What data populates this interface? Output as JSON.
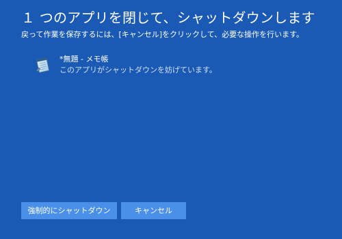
{
  "dialog": {
    "title": "１ つのアプリを閉じて、シャットダウンします",
    "subtitle": "戻って作業を保存するには、[キャンセル]をクリックして、必要な操作を行います。"
  },
  "apps": [
    {
      "name": "*無題 - メモ帳",
      "status": "このアプリがシャットダウンを妨げています。",
      "icon": "notepad-icon"
    }
  ],
  "buttons": {
    "force_shutdown_label": "強制的にシャットダウン",
    "cancel_label": "キャンセル"
  },
  "colors": {
    "background": "#1b5ab4",
    "button": "#4a90e8",
    "text": "#ffffff"
  }
}
